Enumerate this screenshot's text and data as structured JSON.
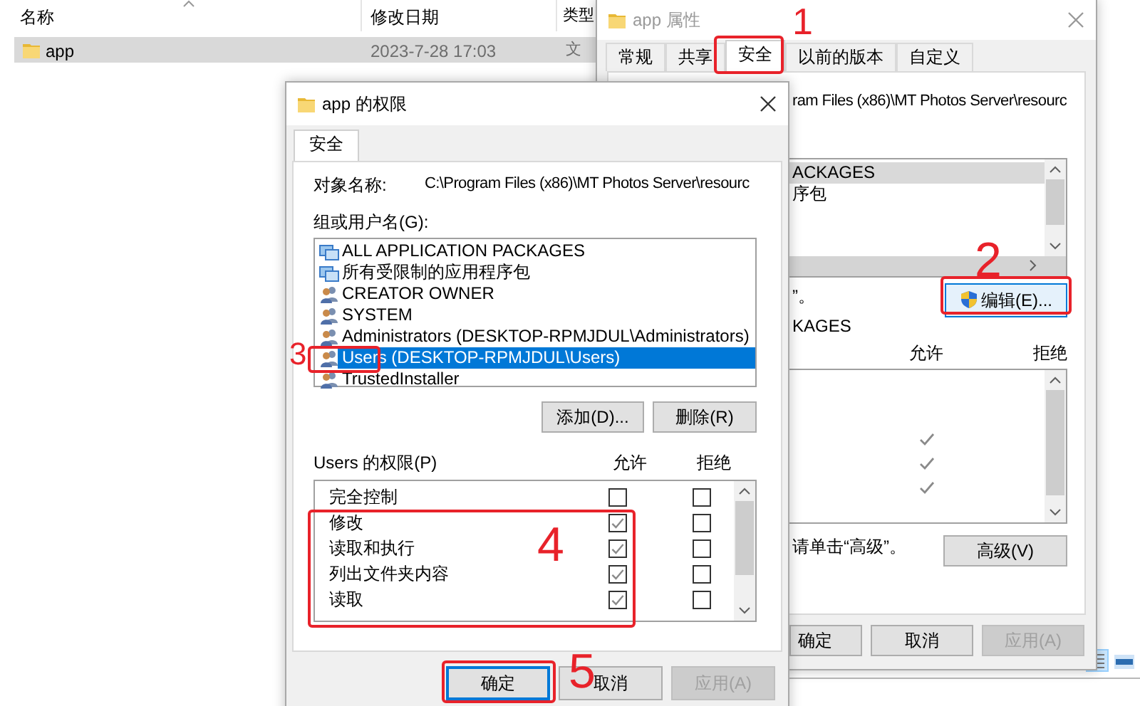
{
  "explorer": {
    "columns": [
      "名称",
      "修改日期",
      "类型"
    ],
    "rows": [
      {
        "name": "app",
        "modified": "2023-7-28 17:03",
        "type": "文",
        "selected": true
      }
    ]
  },
  "properties_window": {
    "title": "app 属性",
    "tabs": [
      {
        "label": "常规",
        "selected": false
      },
      {
        "label": "共享",
        "selected": false
      },
      {
        "label": "安全",
        "selected": true
      },
      {
        "label": "以前的版本",
        "selected": false
      },
      {
        "label": "自定义",
        "selected": false
      }
    ],
    "object_path": "ram Files (x86)\\MT Photos Server\\resourc",
    "principals": [
      {
        "label": "ACKAGES",
        "selected": true
      },
      {
        "label": "序包",
        "selected": false
      }
    ],
    "edit_note": "”。",
    "edit_button": "编辑(E)...",
    "permissions_title": "KAGES",
    "allow_header": "允许",
    "deny_header": "拒绝",
    "permissions": [
      {
        "allow": false
      },
      {
        "allow": false
      },
      {
        "allow": true
      },
      {
        "allow": true
      },
      {
        "allow": true
      }
    ],
    "advanced_note": "请单击“高级”。",
    "advanced_button": "高级(V)",
    "buttons": [
      {
        "label": "确定",
        "disabled": false
      },
      {
        "label": "取消",
        "disabled": false
      },
      {
        "label": "应用(A)",
        "disabled": true
      }
    ]
  },
  "permissions_dialog": {
    "title": "app 的权限",
    "tab": "安全",
    "object_label": "对象名称:",
    "object_path": "C:\\Program Files (x86)\\MT Photos Server\\resourc",
    "principals_label": "组或用户名(G):",
    "principals": [
      {
        "label": "ALL APPLICATION PACKAGES",
        "kind": "package",
        "selected": false
      },
      {
        "label": "所有受限制的应用程序包",
        "kind": "package",
        "selected": false
      },
      {
        "label": "CREATOR OWNER",
        "kind": "user",
        "selected": false
      },
      {
        "label": "SYSTEM",
        "kind": "user",
        "selected": false
      },
      {
        "label": "Administrators (DESKTOP-RPMJDUL\\Administrators)",
        "kind": "user",
        "selected": false
      },
      {
        "label": "Users (DESKTOP-RPMJDUL\\Users)",
        "kind": "user",
        "selected": true
      },
      {
        "label": "TrustedInstaller",
        "kind": "user",
        "selected": false
      }
    ],
    "add_button": "添加(D)...",
    "remove_button": "删除(R)",
    "permissions_label": "Users 的权限(P)",
    "allow_header": "允许",
    "deny_header": "拒绝",
    "permissions": [
      {
        "label": "完全控制",
        "allow": false,
        "deny": false
      },
      {
        "label": "修改",
        "allow": true,
        "deny": false
      },
      {
        "label": "读取和执行",
        "allow": true,
        "deny": false
      },
      {
        "label": "列出文件夹内容",
        "allow": true,
        "deny": false
      },
      {
        "label": "读取",
        "allow": true,
        "deny": false
      }
    ],
    "buttons": [
      {
        "label": "确定",
        "default": true,
        "disabled": false
      },
      {
        "label": "取消",
        "default": false,
        "disabled": false
      },
      {
        "label": "应用(A)",
        "default": false,
        "disabled": true
      }
    ]
  },
  "annotations": [
    {
      "label": "1"
    },
    {
      "label": "2"
    },
    {
      "label": "3"
    },
    {
      "label": "4"
    },
    {
      "label": "5"
    }
  ]
}
